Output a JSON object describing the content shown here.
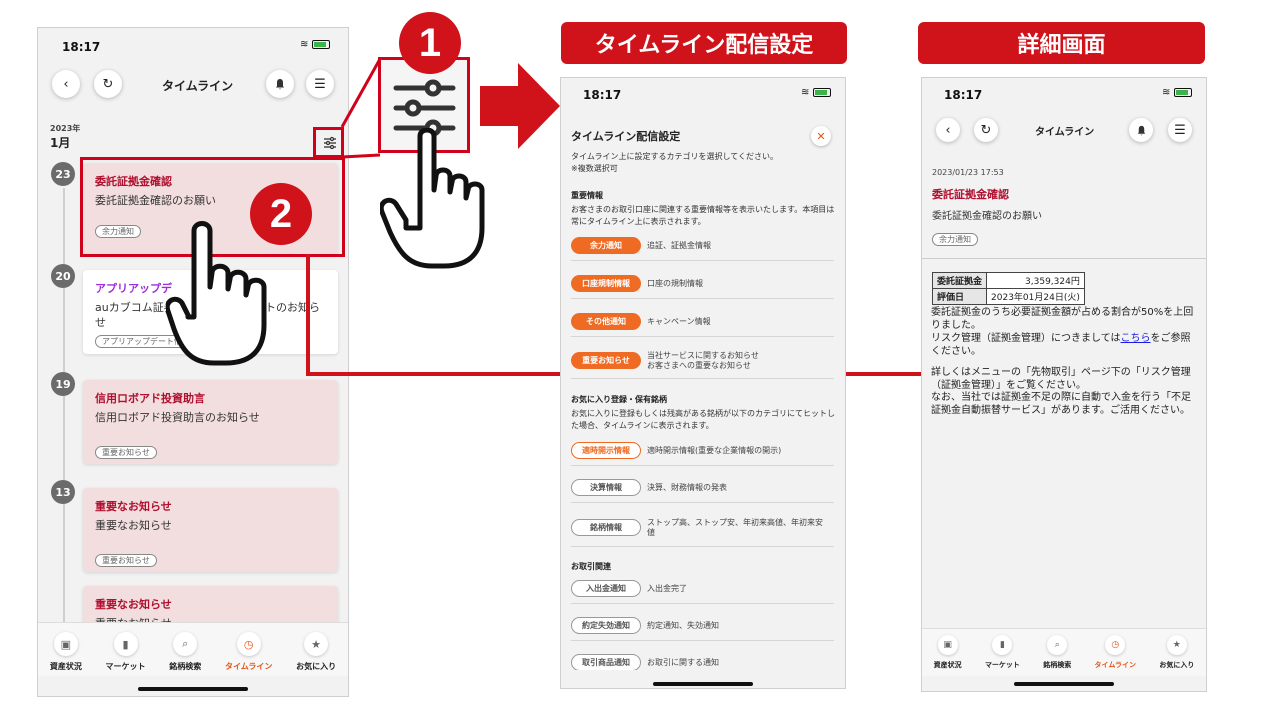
{
  "phone1": {
    "status_time": "18:17",
    "nav_title": "タイムライン",
    "year": "2023年",
    "month": "1月",
    "entries": [
      {
        "day": "23",
        "title": "委託証拠金確認",
        "body": "委託証拠金確認のお願い",
        "tag": "余力通知"
      },
      {
        "day": "20",
        "title": "アプリアップデ",
        "body": "auカブコム証券",
        "body_tail": "トのお知ら",
        "body2": "せ",
        "tag": "アプリアップデート情報"
      },
      {
        "day": "19",
        "title": "信用ロボアド投資助言",
        "body": "信用ロボアド投資助言のお知らせ",
        "tag": "重要お知らせ"
      },
      {
        "day": "13",
        "title": "重要なお知らせ",
        "body": "重要なお知らせ",
        "tag": "重要お知らせ"
      },
      {
        "title": "重要なお知らせ",
        "body": "重要なお知らせ"
      }
    ],
    "tabs": [
      {
        "label": "資産状況",
        "icon": "wallet-icon"
      },
      {
        "label": "マーケット",
        "icon": "bar-chart-icon"
      },
      {
        "label": "銘柄検索",
        "icon": "search-icon"
      },
      {
        "label": "タイムライン",
        "icon": "clock-icon",
        "active": true
      },
      {
        "label": "お気に入り",
        "icon": "star-icon"
      }
    ]
  },
  "callouts": {
    "step1": "1",
    "step2": "2",
    "settings_banner": "タイムライン配信設定",
    "detail_banner": "詳細画面"
  },
  "settings": {
    "status_time": "18:17",
    "title": "タイムライン配信設定",
    "intro": "タイムライン上に設定するカテゴリを選択してください。",
    "intro_note": "※複数選択可",
    "sections": [
      {
        "heading": "重要情報",
        "desc": "お客さまのお取引口座に関連する重要情報等を表示いたします。本項目は常にタイムライン上に表示されます。",
        "rows": [
          {
            "pill": "余力通知",
            "desc": "追証、証拠金情報",
            "style": "on"
          },
          {
            "pill": "口座規制情報",
            "desc": "口座の規制情報",
            "style": "on"
          },
          {
            "pill": "その他通知",
            "desc": "キャンペーン情報",
            "style": "on"
          },
          {
            "pill": "重要お知らせ",
            "desc": "当社サービスに関するお知らせ",
            "desc2": "お客さまへの重要なお知らせ",
            "style": "on"
          }
        ]
      },
      {
        "heading": "お気に入り登録・保有銘柄",
        "desc": "お気に入りに登録もしくは残高がある銘柄が以下のカテゴリにてヒットした場合、タイムラインに表示されます。",
        "rows": [
          {
            "pill": "適時開示情報",
            "desc": "適時開示情報(重要な企業情報の開示)",
            "style": "outline-or"
          },
          {
            "pill": "決算情報",
            "desc": "決算、財務情報の発表",
            "style": "outline-gr"
          },
          {
            "pill": "銘柄情報",
            "desc": "ストップ高、ストップ安、年初来高値、年初来安",
            "desc2": "値",
            "style": "outline-gr"
          }
        ]
      },
      {
        "heading": "お取引関連",
        "rows": [
          {
            "pill": "入出金通知",
            "desc": "入出金完了",
            "style": "outline-gr"
          },
          {
            "pill": "約定失効通知",
            "desc": "約定通知、失効通知",
            "style": "outline-gr"
          },
          {
            "pill": "取引商品通知",
            "desc": "お取引に関する通知",
            "style": "outline-gr"
          }
        ]
      }
    ]
  },
  "detail": {
    "status_time": "18:17",
    "nav_title": "タイムライン",
    "datetime": "2023/01/23 17:53",
    "title": "委託証拠金確認",
    "subtitle": "委託証拠金確認のお願い",
    "tag": "余力通知",
    "table": [
      {
        "key": "委託証拠金",
        "value": "3,359,324円"
      },
      {
        "key": "評価日",
        "value": "2023年01月24日(火)"
      }
    ],
    "para1": "委託証拠金のうち必要証拠金額が占める割合が50%を上回りました。",
    "para2_pre": "リスク管理（証拠金管理）につきましては",
    "para2_link": "こちら",
    "para2_post": "をご参照ください。",
    "para3": "詳しくはメニューの「先物取引」ページ下の「リスク管理（証拠金管理）」をご覧ください。",
    "para4": "なお、当社では証拠金不足の際に自動で入金を行う「不足証拠金自動振替サービス」があります。ご活用ください。",
    "tabs": [
      {
        "label": "資産状況",
        "icon": "wallet-icon"
      },
      {
        "label": "マーケット",
        "icon": "bar-chart-icon"
      },
      {
        "label": "銘柄検索",
        "icon": "search-icon"
      },
      {
        "label": "タイムライン",
        "icon": "clock-icon",
        "active": true
      },
      {
        "label": "お気に入り",
        "icon": "star-icon"
      }
    ]
  },
  "colors": {
    "accent_red": "#d0121b",
    "accent_orange": "#ef6a22",
    "card_pink": "#f2dede"
  }
}
